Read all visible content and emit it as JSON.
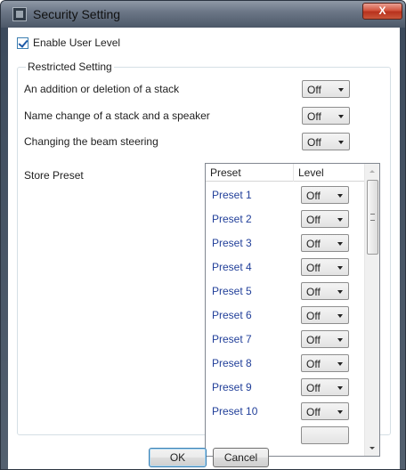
{
  "window": {
    "title": "Security Setting",
    "close_label": "X"
  },
  "enable_user_level": {
    "label": "Enable User Level",
    "checked": true
  },
  "restricted": {
    "title": "Restricted Setting",
    "rows": [
      {
        "label": "An addition or deletion of a stack",
        "value": "Off"
      },
      {
        "label": "Name change of a stack and a speaker",
        "value": "Off"
      },
      {
        "label": "Changing the beam steering",
        "value": "Off"
      }
    ],
    "store_preset_label": "Store Preset"
  },
  "preset_table": {
    "columns": [
      "Preset",
      "Level"
    ],
    "rows": [
      {
        "name": "Preset 1",
        "level": "Off"
      },
      {
        "name": "Preset 2",
        "level": "Off"
      },
      {
        "name": "Preset 3",
        "level": "Off"
      },
      {
        "name": "Preset 4",
        "level": "Off"
      },
      {
        "name": "Preset 5",
        "level": "Off"
      },
      {
        "name": "Preset 6",
        "level": "Off"
      },
      {
        "name": "Preset 7",
        "level": "Off"
      },
      {
        "name": "Preset 8",
        "level": "Off"
      },
      {
        "name": "Preset 9",
        "level": "Off"
      },
      {
        "name": "Preset 10",
        "level": "Off"
      }
    ]
  },
  "buttons": {
    "ok": "OK",
    "cancel": "Cancel"
  }
}
